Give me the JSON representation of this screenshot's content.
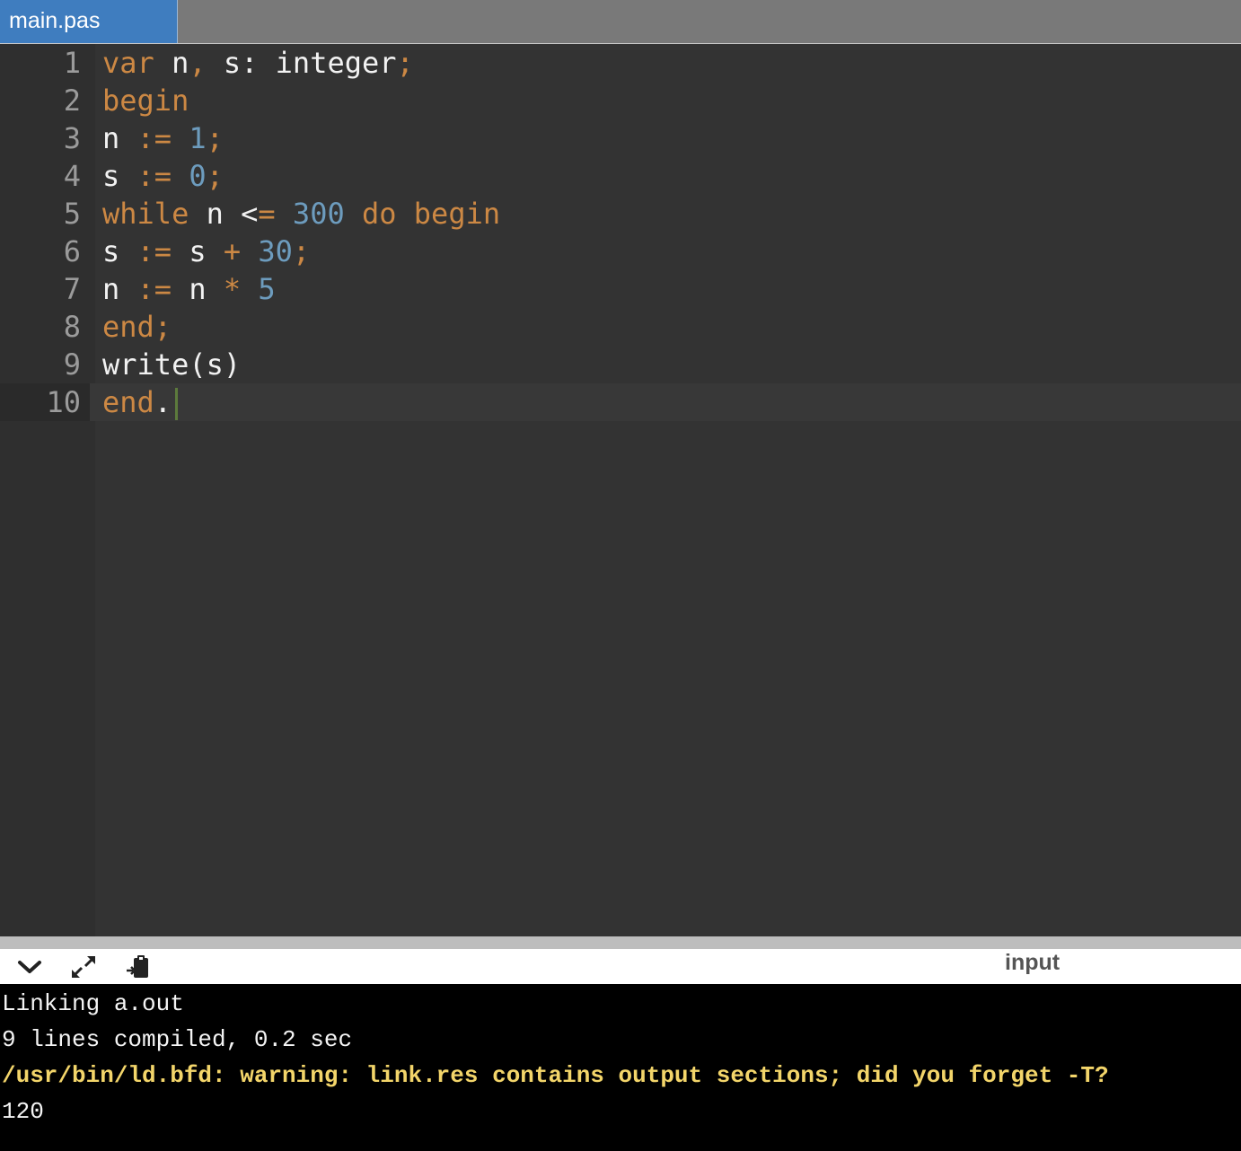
{
  "tab": {
    "filename": "main.pas"
  },
  "editor": {
    "active_line": 10,
    "lines": [
      {
        "n": "1",
        "tokens": [
          [
            "kw",
            "var"
          ],
          [
            "id",
            " n"
          ],
          [
            "op",
            ","
          ],
          [
            "id",
            " s: integer"
          ],
          [
            "op",
            ";"
          ]
        ]
      },
      {
        "n": "2",
        "tokens": [
          [
            "kw",
            "begin"
          ]
        ]
      },
      {
        "n": "3",
        "tokens": [
          [
            "id",
            "n "
          ],
          [
            "op",
            ":="
          ],
          [
            "id",
            " "
          ],
          [
            "num",
            "1"
          ],
          [
            "op",
            ";"
          ]
        ]
      },
      {
        "n": "4",
        "tokens": [
          [
            "id",
            "s "
          ],
          [
            "op",
            ":="
          ],
          [
            "id",
            " "
          ],
          [
            "num",
            "0"
          ],
          [
            "op",
            ";"
          ]
        ]
      },
      {
        "n": "5",
        "tokens": [
          [
            "kw",
            "while"
          ],
          [
            "id",
            " n <"
          ],
          [
            "op",
            "="
          ],
          [
            "id",
            " "
          ],
          [
            "num",
            "300"
          ],
          [
            "id",
            " "
          ],
          [
            "kw",
            "do"
          ],
          [
            "id",
            " "
          ],
          [
            "kw",
            "begin"
          ]
        ]
      },
      {
        "n": "6",
        "tokens": [
          [
            "id",
            "s "
          ],
          [
            "op",
            ":="
          ],
          [
            "id",
            " s "
          ],
          [
            "op",
            "+"
          ],
          [
            "id",
            " "
          ],
          [
            "num",
            "30"
          ],
          [
            "op",
            ";"
          ]
        ]
      },
      {
        "n": "7",
        "tokens": [
          [
            "id",
            "n "
          ],
          [
            "op",
            ":="
          ],
          [
            "id",
            " n "
          ],
          [
            "op",
            "*"
          ],
          [
            "id",
            " "
          ],
          [
            "num",
            "5"
          ]
        ]
      },
      {
        "n": "8",
        "tokens": [
          [
            "kw",
            "end"
          ],
          [
            "op",
            ";"
          ]
        ]
      },
      {
        "n": "9",
        "tokens": [
          [
            "id",
            "write(s)"
          ]
        ]
      },
      {
        "n": "10",
        "tokens": [
          [
            "kw",
            "end"
          ],
          [
            "id",
            "."
          ]
        ]
      }
    ]
  },
  "console_toolbar": {
    "collapse_icon": "chevron-down-icon",
    "expand_icon": "expand-arrows-icon",
    "clipboard_icon": "paste-clipboard-icon",
    "input_label": "input"
  },
  "console": {
    "lines": [
      {
        "text": "Linking a.out",
        "style": "normal"
      },
      {
        "text": "9 lines compiled, 0.2 sec",
        "style": "normal"
      },
      {
        "text": "/usr/bin/ld.bfd: warning: link.res contains output sections; did you forget -T?",
        "style": "warn"
      },
      {
        "text": "120",
        "style": "normal"
      }
    ]
  },
  "colors": {
    "keyword": "#cc8844",
    "number": "#6d9cbe",
    "identifier": "#f2f2f2",
    "tab_active": "#3f7dbf",
    "console_warning": "#f3d56a"
  }
}
